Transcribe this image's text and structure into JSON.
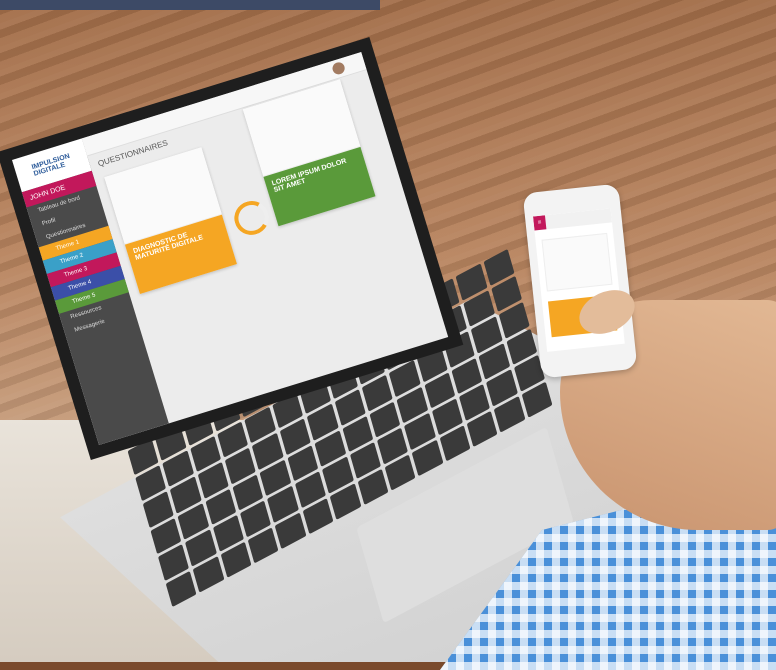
{
  "laptop": {
    "sidebar": {
      "logo_line1": "IMPULSION",
      "logo_line2": "DIGITALE",
      "user": "JOHN DOE",
      "items": [
        "Tableau de bord",
        "Profil",
        "Questionnaires"
      ],
      "themes": [
        "Theme 1",
        "Theme 2",
        "Theme 3",
        "Theme 4",
        "Theme 5"
      ],
      "lower_items": [
        "Ressources",
        "Messagerie"
      ]
    },
    "main": {
      "title": "QUESTIONNAIRES",
      "card1_title": "DIAGNOSTIC DE MATURITÉ DIGITALE",
      "card2_title": "LOREM IPSUM DOLOR SIT AMET"
    }
  },
  "colors": {
    "accent_orange": "#f5a623",
    "accent_green": "#5a9a3a",
    "accent_magenta": "#c2185b",
    "theme_colors": [
      "#f5a623",
      "#3aa0c8",
      "#c2185b",
      "#3b4fa8",
      "#5a9a3a"
    ]
  }
}
